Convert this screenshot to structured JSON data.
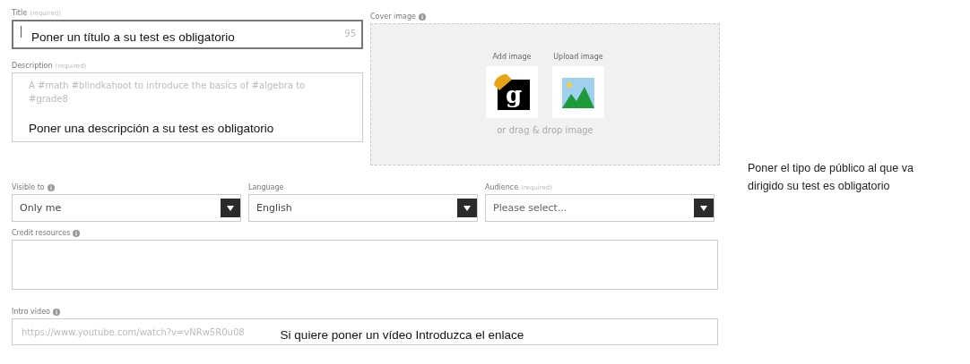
{
  "title_field": {
    "label": "Title",
    "note": "(required)",
    "counter": "95",
    "annotation": "Poner un título a su test  es obligatorio"
  },
  "description_field": {
    "label": "Description",
    "note": "(required)",
    "placeholder": "A #math #blindkahoot to introduce the basics of #algebra to #grade8",
    "annotation": "Poner una descripción a su test  es obligatorio"
  },
  "cover_image": {
    "label": "Cover image",
    "options": [
      {
        "label": "Add image",
        "kind": "library",
        "logo": "g"
      },
      {
        "label": "Upload image",
        "kind": "upload"
      }
    ],
    "drop_hint": "or drag & drop image"
  },
  "selects": [
    {
      "label": "Visible to",
      "info": true,
      "value": "Only me",
      "placeholder": false
    },
    {
      "label": "Language",
      "info": false,
      "value": "English",
      "placeholder": false
    },
    {
      "label": "Audience",
      "note": "(required)",
      "info": false,
      "value": "Please select...",
      "placeholder": true
    }
  ],
  "credit_resources": {
    "label": "Credit resources"
  },
  "intro_video": {
    "label": "Intro video",
    "placeholder": "https://www.youtube.com/watch?v=vNRw5R0u08",
    "annotation": "Si quiere poner un vídeo Introduzca el enlace"
  },
  "side_note": "Poner el tipo de público al que va dirigido su test  es obligatorio"
}
